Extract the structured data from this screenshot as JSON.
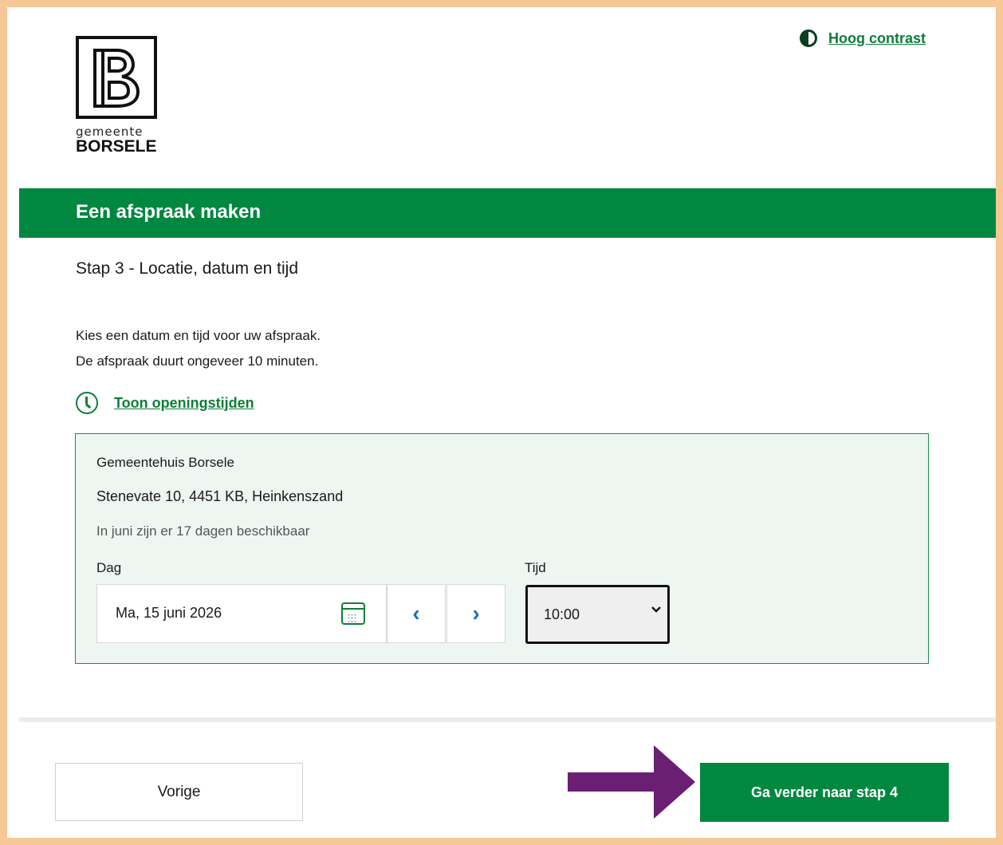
{
  "brand": {
    "sub": "gemeente",
    "name": "BORSELE"
  },
  "header": {
    "contrast_label": "Hoog contrast"
  },
  "page": {
    "title": "Een afspraak maken",
    "step": "Stap 3 - Locatie, datum en tijd",
    "intro_line1": "Kies een datum en tijd voor uw afspraak.",
    "intro_line2": "De afspraak duurt ongeveer 10 minuten.",
    "hours_link": "Toon openingstijden"
  },
  "location": {
    "name": "Gemeentehuis Borsele",
    "address": "Stenevate 10, 4451 KB, Heinkenszand",
    "availability": "In juni zijn er 17 dagen beschikbaar",
    "day_label": "Dag",
    "day_value": "Ma, 15 juni 2026",
    "time_label": "Tijd",
    "time_value": "10:00"
  },
  "footer": {
    "prev_label": "Vorige",
    "next_label": "Ga verder naar stap 4"
  },
  "colors": {
    "brand_green": "#008740",
    "link_green": "#0e7d3a",
    "nav_blue": "#1b6fb5",
    "arrow_purple": "#6b1f73",
    "frame_border": "#f5c896"
  }
}
